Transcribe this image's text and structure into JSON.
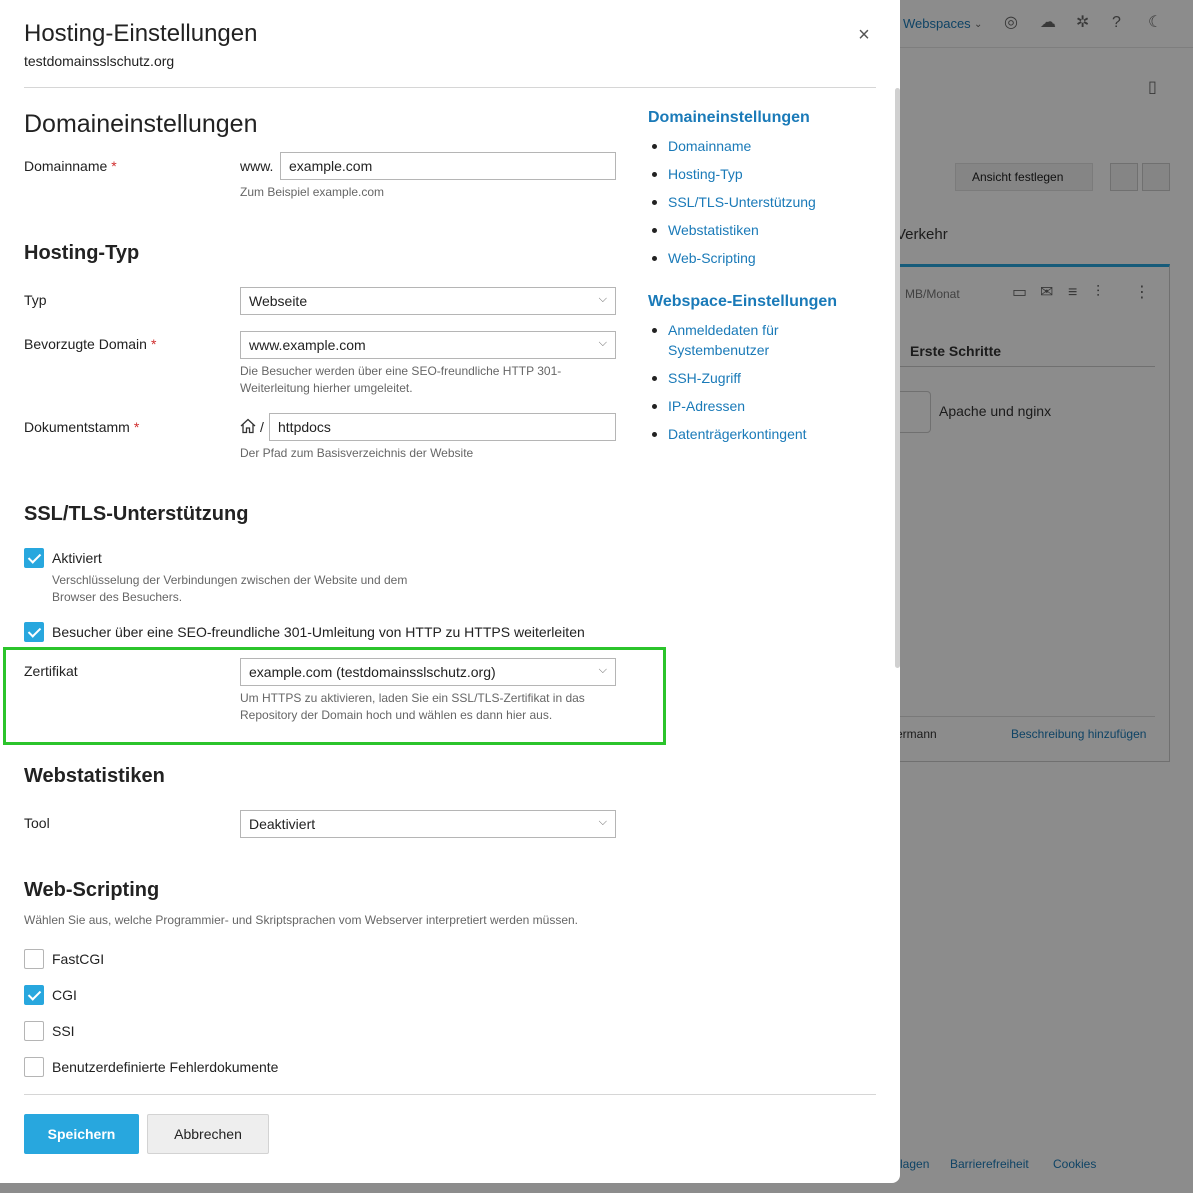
{
  "modal": {
    "title": "Hosting-Einstellungen",
    "subtitle": "testdomainsslschutz.org",
    "close_label": "×"
  },
  "domain_section": {
    "heading": "Domaineinstellungen",
    "domain_label": "Domainname",
    "domain_prefix": "www.",
    "domain_value": "example.com",
    "domain_hint": "Zum Beispiel example.com"
  },
  "hosting_section": {
    "heading": "Hosting-Typ",
    "type_label": "Typ",
    "type_value": "Webseite",
    "preferred_label": "Bevorzugte Domain",
    "preferred_value": "www.example.com",
    "preferred_hint_1": "Die Besucher werden über eine SEO-freundliche HTTP 301-",
    "preferred_hint_2": "Weiterleitung hierher umgeleitet.",
    "docroot_label": "Dokumentstamm",
    "docroot_sep": "/",
    "docroot_value": "httpdocs",
    "docroot_hint": "Der Pfad zum Basisverzeichnis der Website"
  },
  "ssl_section": {
    "heading": "SSL/TLS-Unterstützung",
    "enabled_label": "Aktiviert",
    "enabled_checked": true,
    "enabled_hint_1": "Verschlüsselung der Verbindungen zwischen der Website und dem",
    "enabled_hint_2": "Browser des Besuchers.",
    "redirect_label": "Besucher über eine SEO-freundliche 301-Umleitung von HTTP zu HTTPS weiterleiten",
    "redirect_checked": true,
    "cert_label": "Zertifikat",
    "cert_value": "example.com (testdomainsslschutz.org)",
    "cert_hint_1": "Um HTTPS zu aktivieren, laden Sie ein SSL/TLS-Zertifikat in das",
    "cert_hint_2": "Repository der Domain hoch und wählen es dann hier aus."
  },
  "stats_section": {
    "heading": "Webstatistiken",
    "tool_label": "Tool",
    "tool_value": "Deaktiviert"
  },
  "scripting_section": {
    "heading": "Web-Scripting",
    "description": "Wählen Sie aus, welche Programmier- und Skriptsprachen vom Webserver interpretiert werden müssen.",
    "options": [
      {
        "label": "FastCGI",
        "checked": false
      },
      {
        "label": "CGI",
        "checked": true
      },
      {
        "label": "SSI",
        "checked": false
      },
      {
        "label": "Benutzerdefinierte Fehlerdokumente",
        "checked": false
      }
    ]
  },
  "toc": {
    "domain_heading": "Domaineinstellungen",
    "domain_items": [
      "Domainname",
      "Hosting-Typ",
      "SSL/TLS-Unterstützung",
      "Webstatistiken",
      "Web-Scripting"
    ],
    "webspace_heading": "Webspace-Einstellungen",
    "webspace_items": [
      "Anmeldedaten für Systembenutzer",
      "SSH-Zugriff",
      "IP-Adressen",
      "Datenträgerkontingent"
    ]
  },
  "buttons": {
    "save": "Speichern",
    "cancel": "Abbrechen"
  },
  "background": {
    "webspaces": "Webspaces",
    "view_button": "Ansicht festlegen",
    "traffic": "Verkehr",
    "mb_month": "MB/Monat",
    "first_steps": "Erste Schritte",
    "apache": "Apache und nginx",
    "owner_fragment": "ermann",
    "add_description": "Beschreibung hinzufügen",
    "footer_items": [
      "lagen",
      "Barrierefreiheit",
      "Cookies"
    ]
  },
  "colors": {
    "accent": "#28a7de",
    "link": "#1a7ab8",
    "required": "#d02e2e",
    "highlight": "#2bc42b"
  }
}
